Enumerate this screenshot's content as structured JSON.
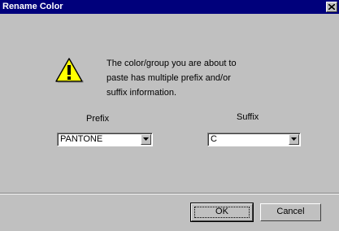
{
  "window": {
    "title": "Rename Color",
    "close_glyph": "x"
  },
  "dialog": {
    "icon": "warning-icon",
    "message_lines": [
      "The color/group you are about to",
      "paste has multiple prefix and/or",
      "suffix information."
    ]
  },
  "prefix": {
    "label": "Prefix",
    "value": "PANTONE"
  },
  "suffix": {
    "label": "Suffix",
    "value": "C"
  },
  "buttons": {
    "ok_label": "OK",
    "cancel_label": "Cancel"
  },
  "colors": {
    "titlebar": "#00007b",
    "face": "#c0c0c0",
    "warning": "#ffff00"
  }
}
